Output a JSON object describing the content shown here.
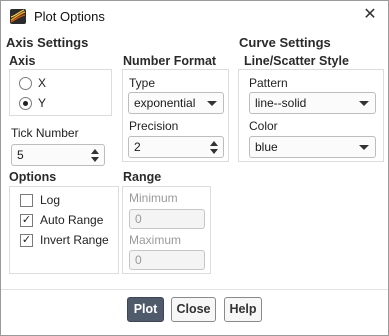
{
  "window": {
    "title": "Plot Options",
    "close_glyph": "✕"
  },
  "axis_settings": {
    "title": "Axis Settings",
    "axis": {
      "label": "Axis",
      "options": [
        {
          "label": "X",
          "checked": false
        },
        {
          "label": "Y",
          "checked": true
        }
      ]
    },
    "number_format": {
      "label": "Number Format",
      "type_label": "Type",
      "type_value": "exponential",
      "precision_label": "Precision",
      "precision_value": "2"
    },
    "tick_number": {
      "label": "Tick Number",
      "value": "5"
    },
    "options": {
      "label": "Options",
      "items": [
        {
          "label": "Log",
          "checked": false
        },
        {
          "label": "Auto Range",
          "checked": true
        },
        {
          "label": "Invert Range",
          "checked": true
        }
      ]
    },
    "range": {
      "label": "Range",
      "minimum_label": "Minimum",
      "minimum_value": "0",
      "maximum_label": "Maximum",
      "maximum_value": "0"
    }
  },
  "curve_settings": {
    "title": "Curve Settings",
    "group_label": "Line/Scatter Style",
    "pattern_label": "Pattern",
    "pattern_value": "line--solid",
    "color_label": "Color",
    "color_value": "blue"
  },
  "buttons": {
    "plot": "Plot",
    "close": "Close",
    "help": "Help"
  },
  "icons": {
    "app": "fluent-app-icon",
    "close": "close-icon"
  },
  "colors": {
    "primary_button": "#4f5b6a"
  }
}
